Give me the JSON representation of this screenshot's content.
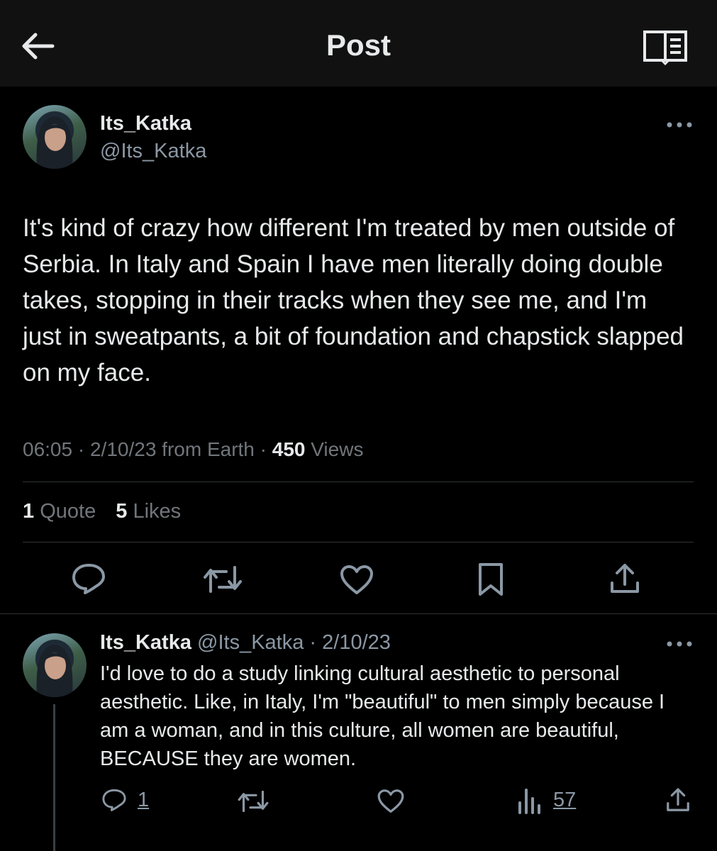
{
  "header": {
    "title": "Post",
    "back_icon": "arrow-left-icon",
    "reader_icon": "book-open-icon"
  },
  "post": {
    "display_name": "Its_Katka",
    "handle": "@Its_Katka",
    "text": "It's kind of crazy how different I'm treated by men outside of Serbia. In Italy and Spain I have men literally doing double takes, stopping in their tracks when they see me, and I'm just in sweatpants, a bit of foundation and chapstick slapped on my face.",
    "time": "06:05",
    "date": "2/10/23",
    "source": "from Earth",
    "views_count": "450",
    "views_label": "Views",
    "quote_count": "1",
    "quote_label": "Quote",
    "likes_count": "5",
    "likes_label": "Likes"
  },
  "reply": {
    "display_name": "Its_Katka",
    "handle": "@Its_Katka",
    "date": "2/10/23",
    "text": "I'd love to do a study linking cultural aesthetic to personal aesthetic. Like, in Italy, I'm \"beautiful\" to men simply because I am a woman, and in this culture, all women are beautiful, BECAUSE they are women.",
    "reply_count": "1",
    "views_count": "57"
  },
  "colors": {
    "background": "#000000",
    "header_bg": "#111111",
    "text": "#e7e9ea",
    "muted": "#71767b",
    "divider": "#2f3336"
  }
}
